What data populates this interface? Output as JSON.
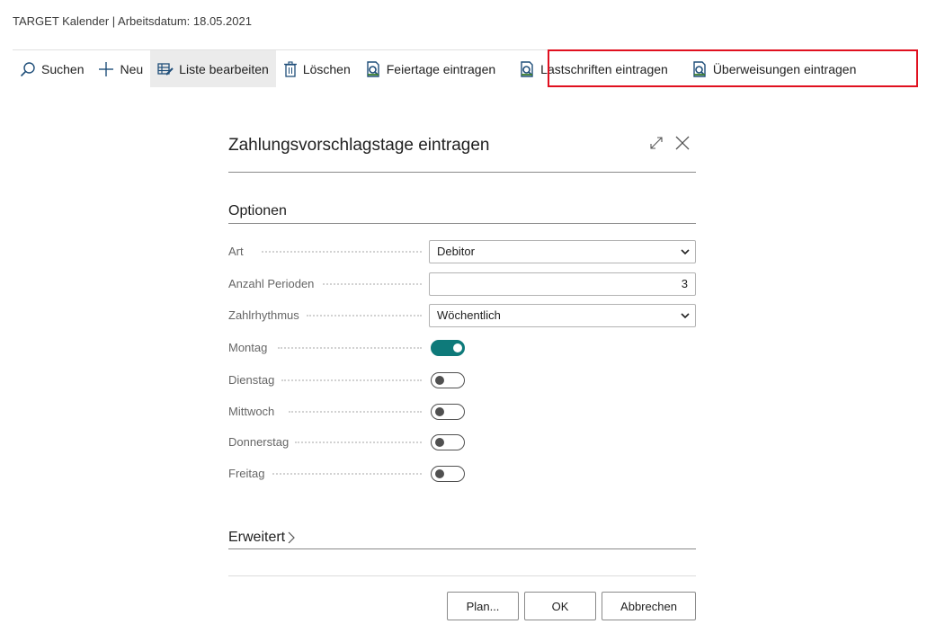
{
  "page": {
    "title": "TARGET Kalender | Arbeitsdatum: 18.05.2021"
  },
  "toolbar": {
    "items": [
      {
        "label": "Suchen",
        "icon": "search-icon"
      },
      {
        "label": "Neu",
        "icon": "plus-icon"
      },
      {
        "label": "Liste bearbeiten",
        "icon": "edit-list-icon",
        "active": true
      },
      {
        "label": "Löschen",
        "icon": "trash-icon"
      },
      {
        "label": "Feiertage eintragen",
        "icon": "report-icon"
      },
      {
        "label": "Lastschriften eintragen",
        "icon": "report-icon"
      },
      {
        "label": "Überweisungen eintragen",
        "icon": "report-icon"
      }
    ],
    "highlight_color": "#e0101f"
  },
  "dialog": {
    "title": "Zahlungsvorschlagstage eintragen",
    "section_options": "Optionen",
    "fields": {
      "art": {
        "label": "Art",
        "value": "Debitor"
      },
      "anzahl_perioden": {
        "label": "Anzahl Perioden",
        "value": "3"
      },
      "zahlrhythmus": {
        "label": "Zahlrhythmus",
        "value": "Wöchentlich"
      }
    },
    "days": [
      {
        "label": "Montag",
        "on": true
      },
      {
        "label": "Dienstag",
        "on": false
      },
      {
        "label": "Mittwoch",
        "on": false
      },
      {
        "label": "Donnerstag",
        "on": false
      },
      {
        "label": "Freitag",
        "on": false
      }
    ],
    "section_advanced": "Erweitert",
    "buttons": {
      "plan": "Plan...",
      "ok": "OK",
      "cancel": "Abbrechen"
    },
    "toggle_on_color": "#0e7a7a"
  }
}
